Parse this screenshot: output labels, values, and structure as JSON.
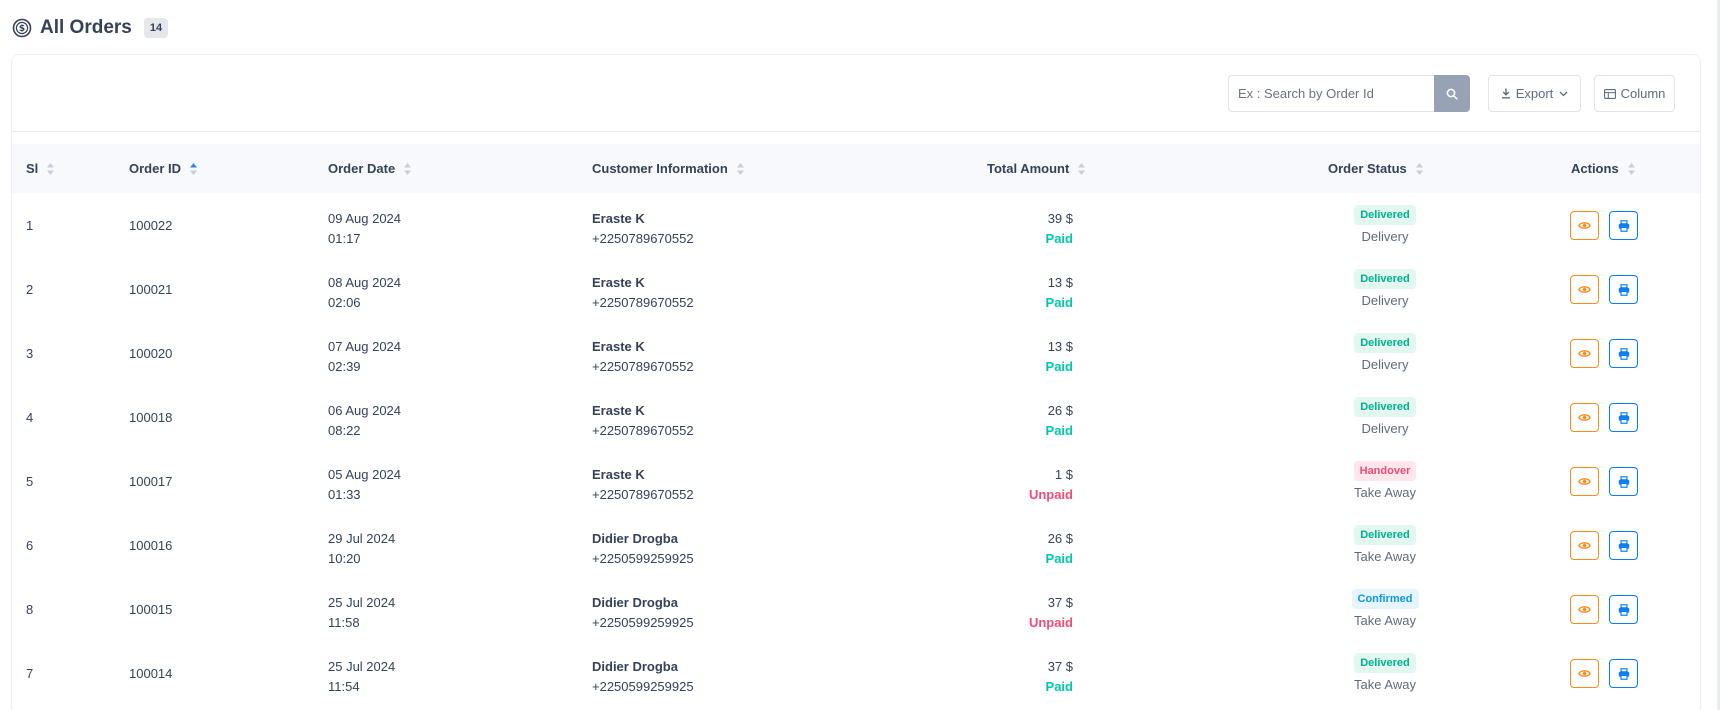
{
  "header": {
    "title": "All Orders",
    "count": "14",
    "icon": "orders-dollar-icon"
  },
  "toolbar": {
    "search_placeholder": "Ex : Search by Order Id",
    "search_icon": "search-icon",
    "export_label": "Export",
    "column_label": "Column"
  },
  "table": {
    "columns": [
      "Sl",
      "Order ID",
      "Order Date",
      "Customer Information",
      "Total Amount",
      "Order Status",
      "Actions"
    ],
    "rows": [
      {
        "sl": "1",
        "order_id": "100022",
        "date": "09 Aug 2024",
        "time": "01:17",
        "customer": "Eraste K",
        "phone": "+2250789670552",
        "amount": "39 $",
        "payment": "Paid",
        "status": "Delivered",
        "order_type": "Delivery"
      },
      {
        "sl": "2",
        "order_id": "100021",
        "date": "08 Aug 2024",
        "time": "02:06",
        "customer": "Eraste K",
        "phone": "+2250789670552",
        "amount": "13 $",
        "payment": "Paid",
        "status": "Delivered",
        "order_type": "Delivery"
      },
      {
        "sl": "3",
        "order_id": "100020",
        "date": "07 Aug 2024",
        "time": "02:39",
        "customer": "Eraste K",
        "phone": "+2250789670552",
        "amount": "13 $",
        "payment": "Paid",
        "status": "Delivered",
        "order_type": "Delivery"
      },
      {
        "sl": "4",
        "order_id": "100018",
        "date": "06 Aug 2024",
        "time": "08:22",
        "customer": "Eraste K",
        "phone": "+2250789670552",
        "amount": "26 $",
        "payment": "Paid",
        "status": "Delivered",
        "order_type": "Delivery"
      },
      {
        "sl": "5",
        "order_id": "100017",
        "date": "05 Aug 2024",
        "time": "01:33",
        "customer": "Eraste K",
        "phone": "+2250789670552",
        "amount": "1 $",
        "payment": "Unpaid",
        "status": "Handover",
        "order_type": "Take Away"
      },
      {
        "sl": "6",
        "order_id": "100016",
        "date": "29 Jul 2024",
        "time": "10:20",
        "customer": "Didier Drogba",
        "phone": "+2250599259925",
        "amount": "26 $",
        "payment": "Paid",
        "status": "Delivered",
        "order_type": "Take Away"
      },
      {
        "sl": "8",
        "order_id": "100015",
        "date": "25 Jul 2024",
        "time": "11:58",
        "customer": "Didier Drogba",
        "phone": "+2250599259925",
        "amount": "37 $",
        "payment": "Unpaid",
        "status": "Confirmed",
        "order_type": "Take Away"
      },
      {
        "sl": "7",
        "order_id": "100014",
        "date": "25 Jul 2024",
        "time": "11:54",
        "customer": "Didier Drogba",
        "phone": "+2250599259925",
        "amount": "37 $",
        "payment": "Paid",
        "status": "Delivered",
        "order_type": "Take Away"
      }
    ]
  },
  "colors": {
    "paid": "#00c9a7",
    "unpaid": "#ed4c78",
    "delivered": "#00b18d",
    "handover": "#ed4c78",
    "confirmed": "#0b98d8",
    "view_button": "#ff8a1e",
    "print_button": "#0a7ff5"
  }
}
